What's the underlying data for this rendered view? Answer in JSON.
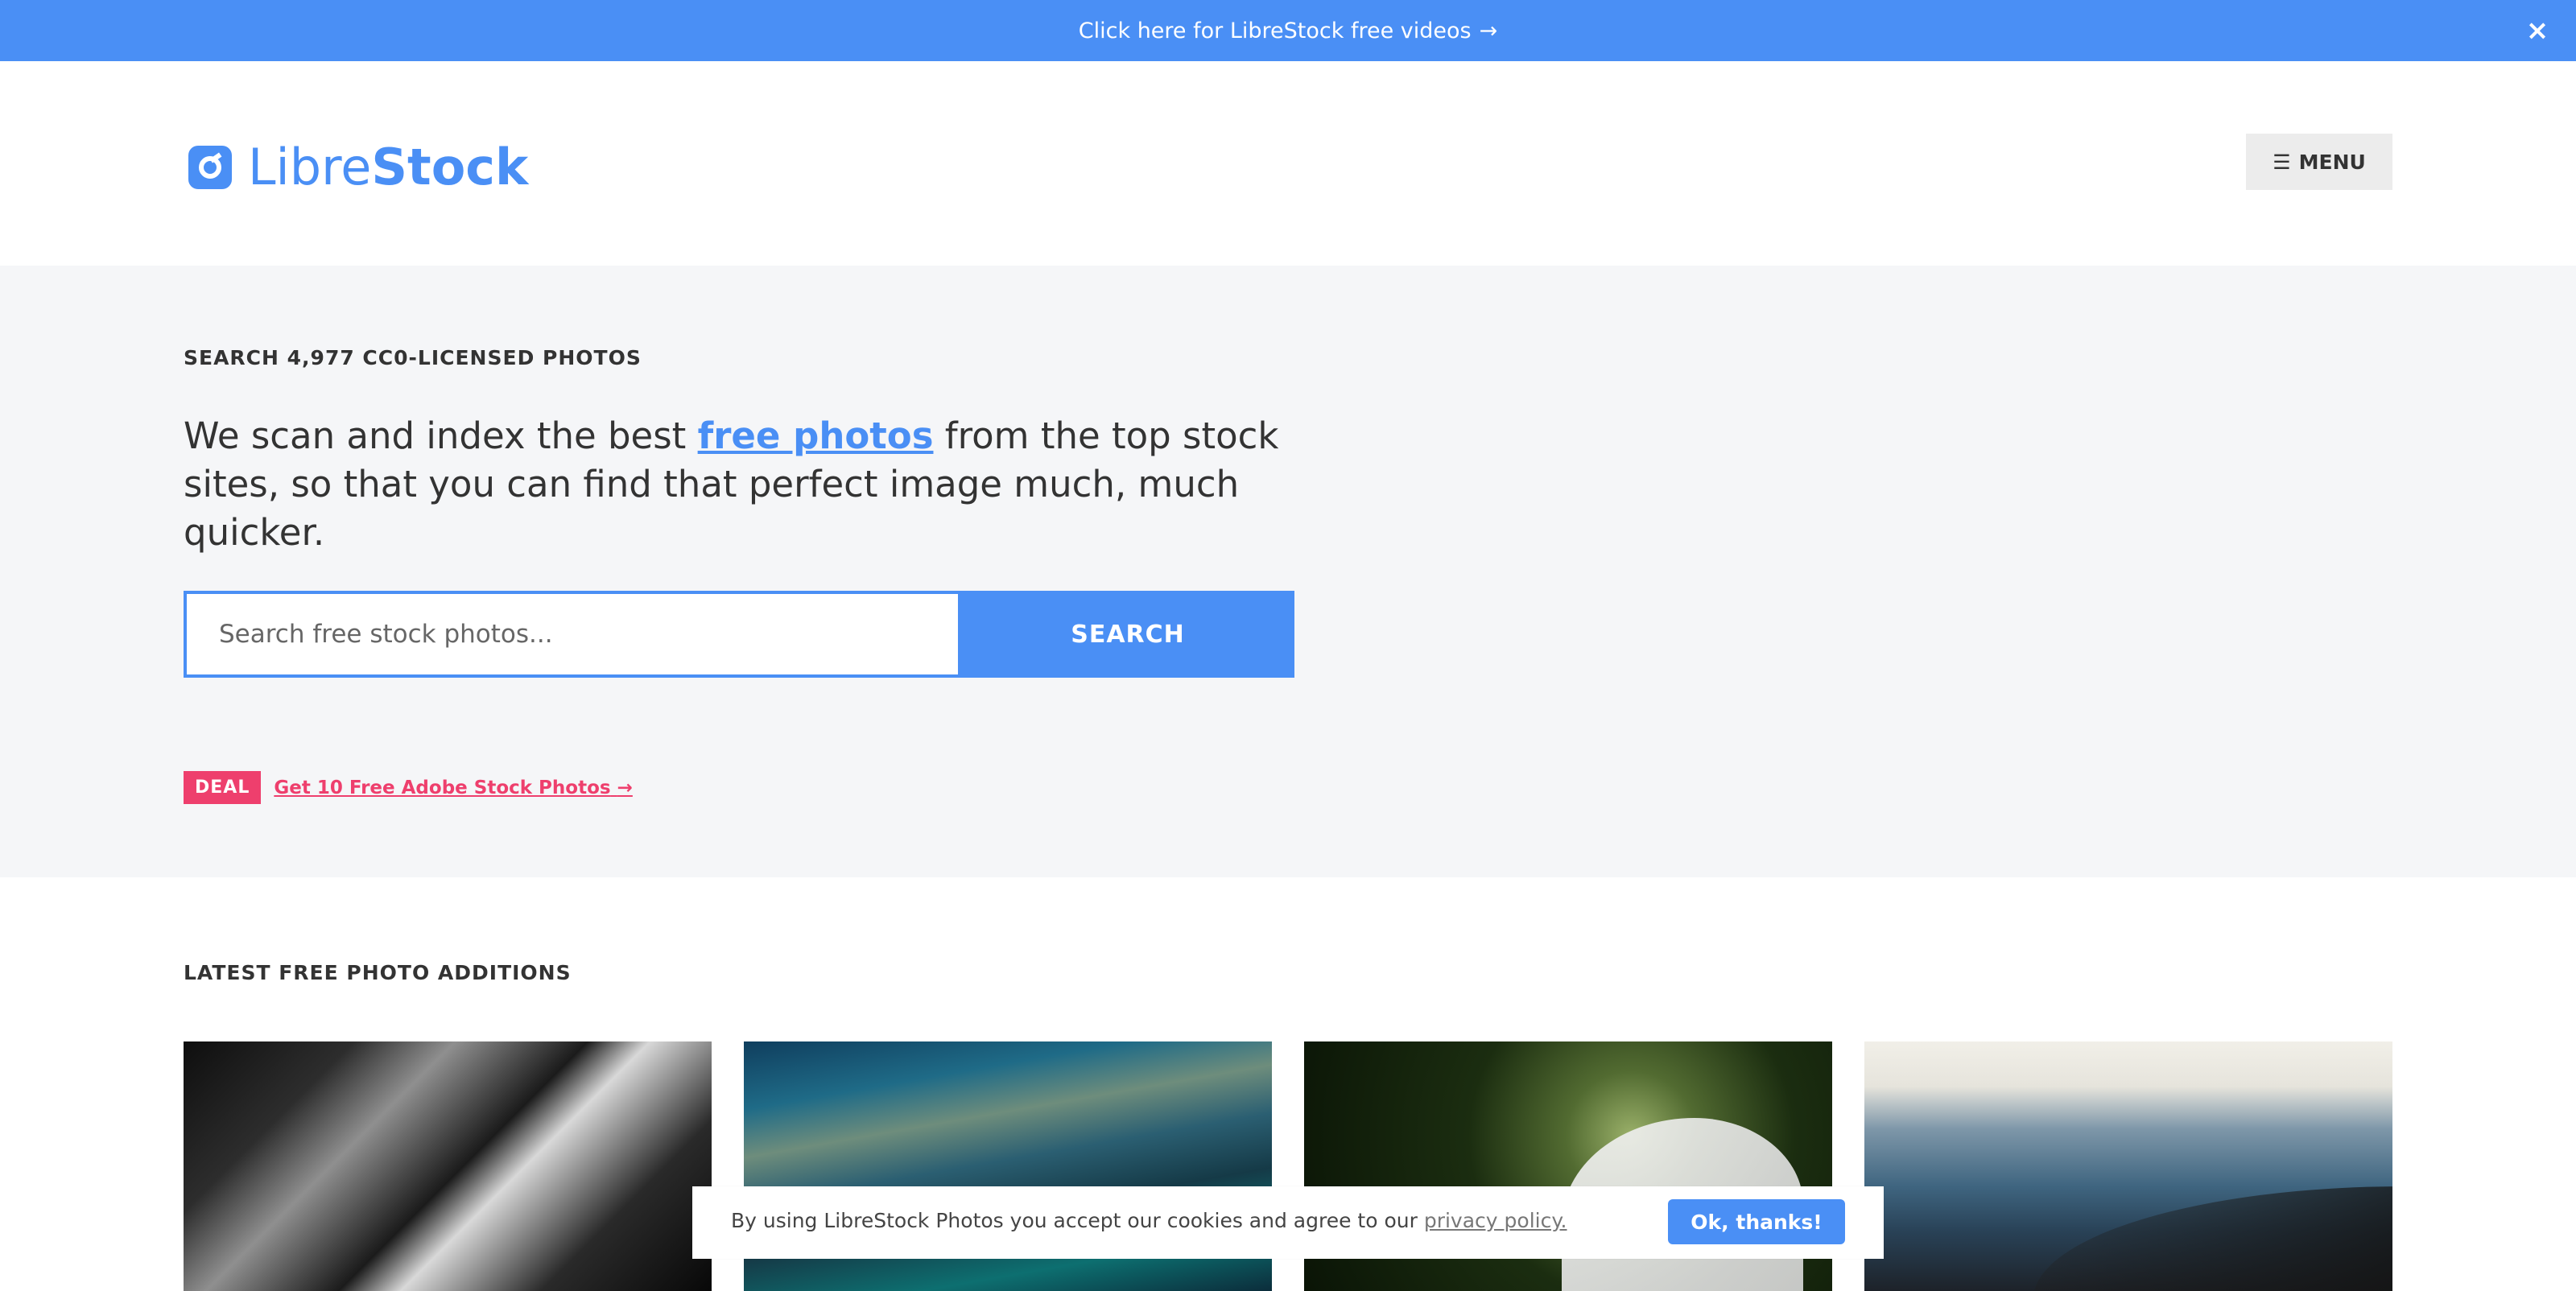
{
  "topbar": {
    "text": "Click here for LibreStock free videos",
    "arrow": "→",
    "close_icon": "×"
  },
  "header": {
    "logo_light": "Libre",
    "logo_bold": "Stock",
    "menu_label": "MENU",
    "menu_icon": "☰"
  },
  "hero": {
    "eyebrow": "SEARCH 4,977 CC0-LICENSED PHOTOS",
    "intro_prefix": "We scan and index the best ",
    "intro_link": "free photos",
    "intro_suffix": " from the top stock sites, so that you can find that perfect image much, much quicker.",
    "search_placeholder": "Search free stock photos...",
    "search_button": "SEARCH",
    "deal_badge": "DEAL",
    "deal_link": "Get 10 Free Adobe Stock Photos",
    "deal_arrow": "→"
  },
  "latest": {
    "title": "LATEST FREE PHOTO ADDITIONS"
  },
  "cookie": {
    "text_prefix": "By using LibreStock Photos you accept our cookies and agree to our ",
    "link": "privacy policy.",
    "button": "Ok, thanks!"
  },
  "colors": {
    "accent": "#4a8ff5",
    "deal": "#ee3f6d"
  }
}
